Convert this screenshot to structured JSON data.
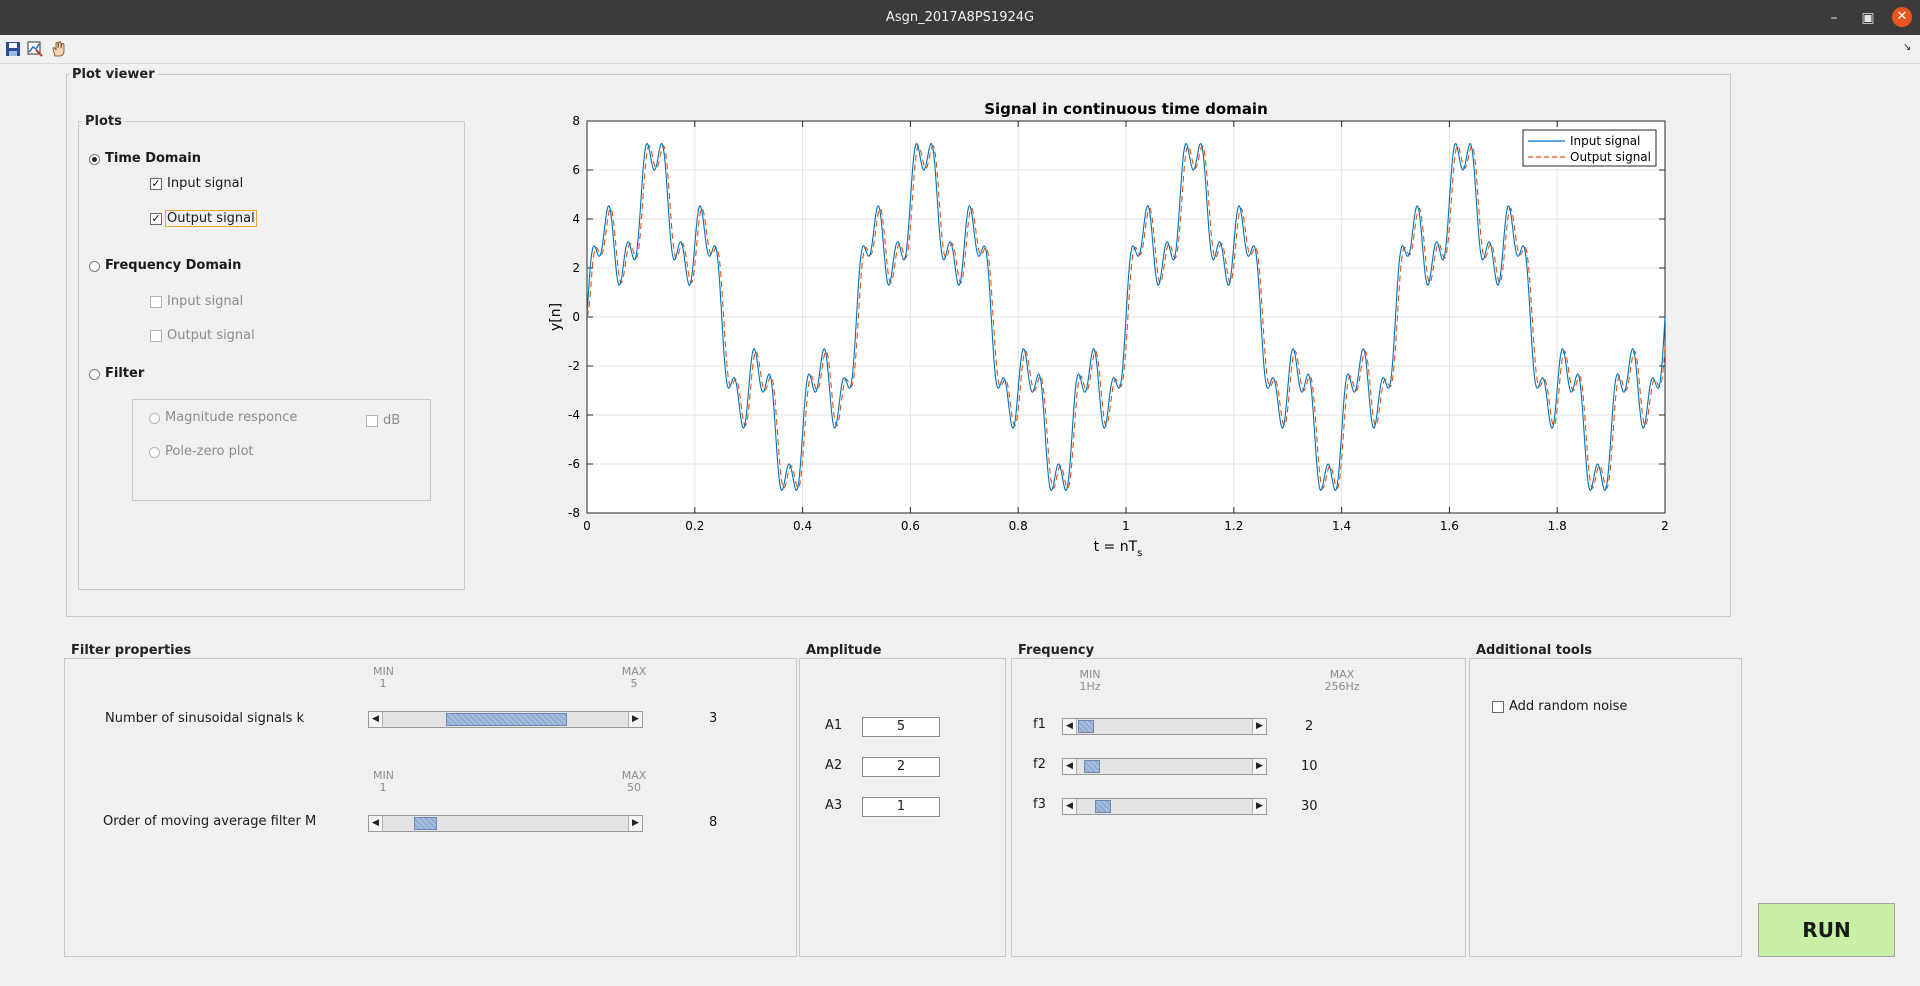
{
  "window": {
    "title": "Asgn_2017A8PS1924G"
  },
  "toolbar": {
    "icons": [
      "save-icon",
      "data-cursor-icon",
      "pan-hand-icon"
    ]
  },
  "plot_viewer": {
    "title": "Plot viewer",
    "plots_panel": {
      "title": "Plots",
      "time_domain": {
        "label": "Time Domain",
        "input": "Input signal",
        "output": "Output signal"
      },
      "frequency_domain": {
        "label": "Frequency Domain",
        "input": "Input signal",
        "output": "Output signal"
      },
      "filter": {
        "label": "Filter",
        "magnitude": "Magnitude responce",
        "pole_zero": "Pole-zero plot",
        "db": "dB"
      }
    }
  },
  "filter_properties": {
    "title": "Filter properties",
    "k": {
      "label": "Number of sinusoidal signals k",
      "min_label": "MIN",
      "min": "1",
      "max_label": "MAX",
      "max": "5",
      "value": "3"
    },
    "m": {
      "label": "Order of moving average filter M",
      "min_label": "MIN",
      "min": "1",
      "max_label": "MAX",
      "max": "50",
      "value": "8"
    }
  },
  "amplitude": {
    "title": "Amplitude",
    "a1": {
      "label": "A1",
      "value": "5"
    },
    "a2": {
      "label": "A2",
      "value": "2"
    },
    "a3": {
      "label": "A3",
      "value": "1"
    }
  },
  "frequency": {
    "title": "Frequency",
    "min_label": "MIN",
    "min": "1Hz",
    "max_label": "MAX",
    "max": "256Hz",
    "f1": {
      "label": "f1",
      "value": "2"
    },
    "f2": {
      "label": "f2",
      "value": "10"
    },
    "f3": {
      "label": "f3",
      "value": "30"
    }
  },
  "additional_tools": {
    "title": "Additional tools",
    "noise": "Add random noise"
  },
  "run": {
    "label": "RUN"
  },
  "chart_data": {
    "type": "line",
    "title": "Signal in continuous time domain",
    "xlabel_main": "t = nT",
    "xlabel_sub": "s",
    "ylabel": "y[n]",
    "xlim": [
      0,
      2
    ],
    "ylim": [
      -8,
      8
    ],
    "xticks": [
      "0",
      "0.2",
      "0.4",
      "0.6",
      "0.8",
      "1",
      "1.2",
      "1.4",
      "1.6",
      "1.8",
      "2"
    ],
    "yticks": [
      "8",
      "6",
      "4",
      "2",
      "0",
      "-2",
      "-4",
      "-6",
      "-8"
    ],
    "grid": true,
    "legend_position": "top-right",
    "series": [
      {
        "name": "Input signal",
        "color": "#0072bd",
        "style": "solid",
        "components": [
          {
            "amp": 5,
            "freq": 2
          },
          {
            "amp": 2,
            "freq": 10
          },
          {
            "amp": 1,
            "freq": 30
          }
        ]
      },
      {
        "name": "Output signal",
        "color": "#d95319",
        "style": "dashed",
        "moving_average_order": 8
      }
    ]
  }
}
